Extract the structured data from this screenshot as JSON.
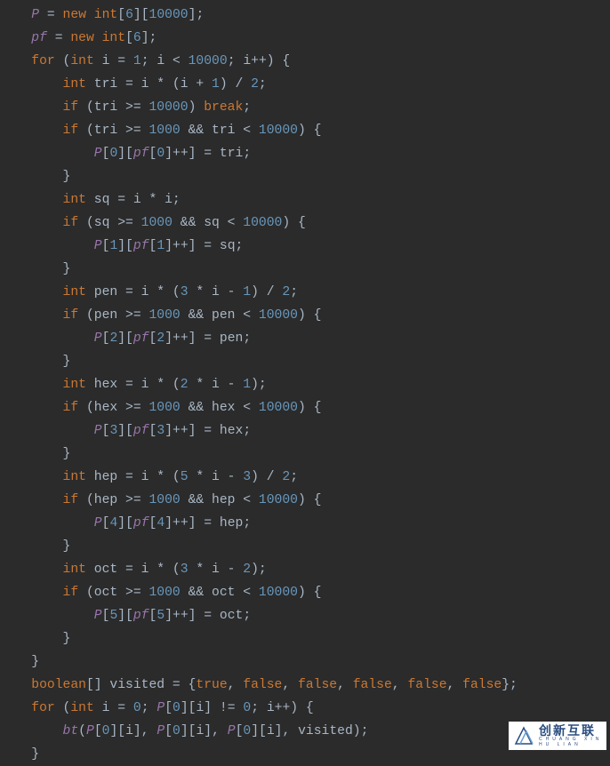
{
  "code": {
    "lines": [
      {
        "indent": 1,
        "tokens": [
          {
            "t": "field",
            "v": "P"
          },
          {
            "t": "op",
            "v": " = "
          },
          {
            "t": "kw",
            "v": "new int"
          },
          {
            "t": "op",
            "v": "["
          },
          {
            "t": "num",
            "v": "6"
          },
          {
            "t": "op",
            "v": "]["
          },
          {
            "t": "num",
            "v": "10000"
          },
          {
            "t": "op",
            "v": "];"
          }
        ]
      },
      {
        "indent": 1,
        "tokens": [
          {
            "t": "field",
            "v": "pf"
          },
          {
            "t": "op",
            "v": " = "
          },
          {
            "t": "kw",
            "v": "new int"
          },
          {
            "t": "op",
            "v": "["
          },
          {
            "t": "num",
            "v": "6"
          },
          {
            "t": "op",
            "v": "];"
          }
        ]
      },
      {
        "indent": 1,
        "tokens": [
          {
            "t": "kw",
            "v": "for"
          },
          {
            "t": "op",
            "v": " ("
          },
          {
            "t": "kw",
            "v": "int"
          },
          {
            "t": "op",
            "v": " i = "
          },
          {
            "t": "num",
            "v": "1"
          },
          {
            "t": "op",
            "v": "; i < "
          },
          {
            "t": "num",
            "v": "10000"
          },
          {
            "t": "op",
            "v": "; i++) {"
          }
        ]
      },
      {
        "indent": 2,
        "tokens": [
          {
            "t": "kw",
            "v": "int"
          },
          {
            "t": "op",
            "v": " tri = i * (i + "
          },
          {
            "t": "num",
            "v": "1"
          },
          {
            "t": "op",
            "v": ") / "
          },
          {
            "t": "num",
            "v": "2"
          },
          {
            "t": "op",
            "v": ";"
          }
        ]
      },
      {
        "indent": 2,
        "tokens": [
          {
            "t": "kw",
            "v": "if"
          },
          {
            "t": "op",
            "v": " (tri >= "
          },
          {
            "t": "num",
            "v": "10000"
          },
          {
            "t": "op",
            "v": ") "
          },
          {
            "t": "kw",
            "v": "break"
          },
          {
            "t": "op",
            "v": ";"
          }
        ]
      },
      {
        "indent": 2,
        "tokens": [
          {
            "t": "kw",
            "v": "if"
          },
          {
            "t": "op",
            "v": " (tri >= "
          },
          {
            "t": "num",
            "v": "1000"
          },
          {
            "t": "op",
            "v": " && tri < "
          },
          {
            "t": "num",
            "v": "10000"
          },
          {
            "t": "op",
            "v": ") {"
          }
        ]
      },
      {
        "indent": 3,
        "tokens": [
          {
            "t": "field",
            "v": "P"
          },
          {
            "t": "op",
            "v": "["
          },
          {
            "t": "num",
            "v": "0"
          },
          {
            "t": "op",
            "v": "]["
          },
          {
            "t": "field",
            "v": "pf"
          },
          {
            "t": "op",
            "v": "["
          },
          {
            "t": "num",
            "v": "0"
          },
          {
            "t": "op",
            "v": "]++] = tri;"
          }
        ]
      },
      {
        "indent": 2,
        "tokens": [
          {
            "t": "op",
            "v": "}"
          }
        ]
      },
      {
        "indent": 2,
        "tokens": [
          {
            "t": "kw",
            "v": "int"
          },
          {
            "t": "op",
            "v": " sq = i * i;"
          }
        ]
      },
      {
        "indent": 2,
        "tokens": [
          {
            "t": "kw",
            "v": "if"
          },
          {
            "t": "op",
            "v": " (sq >= "
          },
          {
            "t": "num",
            "v": "1000"
          },
          {
            "t": "op",
            "v": " && sq < "
          },
          {
            "t": "num",
            "v": "10000"
          },
          {
            "t": "op",
            "v": ") {"
          }
        ]
      },
      {
        "indent": 3,
        "tokens": [
          {
            "t": "field",
            "v": "P"
          },
          {
            "t": "op",
            "v": "["
          },
          {
            "t": "num",
            "v": "1"
          },
          {
            "t": "op",
            "v": "]["
          },
          {
            "t": "field",
            "v": "pf"
          },
          {
            "t": "op",
            "v": "["
          },
          {
            "t": "num",
            "v": "1"
          },
          {
            "t": "op",
            "v": "]++] = sq;"
          }
        ]
      },
      {
        "indent": 2,
        "tokens": [
          {
            "t": "op",
            "v": "}"
          }
        ]
      },
      {
        "indent": 2,
        "tokens": [
          {
            "t": "kw",
            "v": "int"
          },
          {
            "t": "op",
            "v": " pen = i * ("
          },
          {
            "t": "num",
            "v": "3"
          },
          {
            "t": "op",
            "v": " * i - "
          },
          {
            "t": "num",
            "v": "1"
          },
          {
            "t": "op",
            "v": ") / "
          },
          {
            "t": "num",
            "v": "2"
          },
          {
            "t": "op",
            "v": ";"
          }
        ]
      },
      {
        "indent": 2,
        "tokens": [
          {
            "t": "kw",
            "v": "if"
          },
          {
            "t": "op",
            "v": " (pen >= "
          },
          {
            "t": "num",
            "v": "1000"
          },
          {
            "t": "op",
            "v": " && pen < "
          },
          {
            "t": "num",
            "v": "10000"
          },
          {
            "t": "op",
            "v": ") {"
          }
        ]
      },
      {
        "indent": 3,
        "tokens": [
          {
            "t": "field",
            "v": "P"
          },
          {
            "t": "op",
            "v": "["
          },
          {
            "t": "num",
            "v": "2"
          },
          {
            "t": "op",
            "v": "]["
          },
          {
            "t": "field",
            "v": "pf"
          },
          {
            "t": "op",
            "v": "["
          },
          {
            "t": "num",
            "v": "2"
          },
          {
            "t": "op",
            "v": "]++] = pen;"
          }
        ]
      },
      {
        "indent": 2,
        "tokens": [
          {
            "t": "op",
            "v": "}"
          }
        ]
      },
      {
        "indent": 2,
        "tokens": [
          {
            "t": "kw",
            "v": "int"
          },
          {
            "t": "op",
            "v": " hex = i * ("
          },
          {
            "t": "num",
            "v": "2"
          },
          {
            "t": "op",
            "v": " * i - "
          },
          {
            "t": "num",
            "v": "1"
          },
          {
            "t": "op",
            "v": ");"
          }
        ]
      },
      {
        "indent": 2,
        "tokens": [
          {
            "t": "kw",
            "v": "if"
          },
          {
            "t": "op",
            "v": " (hex >= "
          },
          {
            "t": "num",
            "v": "1000"
          },
          {
            "t": "op",
            "v": " && hex < "
          },
          {
            "t": "num",
            "v": "10000"
          },
          {
            "t": "op",
            "v": ") {"
          }
        ]
      },
      {
        "indent": 3,
        "tokens": [
          {
            "t": "field",
            "v": "P"
          },
          {
            "t": "op",
            "v": "["
          },
          {
            "t": "num",
            "v": "3"
          },
          {
            "t": "op",
            "v": "]["
          },
          {
            "t": "field",
            "v": "pf"
          },
          {
            "t": "op",
            "v": "["
          },
          {
            "t": "num",
            "v": "3"
          },
          {
            "t": "op",
            "v": "]++] = hex;"
          }
        ]
      },
      {
        "indent": 2,
        "tokens": [
          {
            "t": "op",
            "v": "}"
          }
        ]
      },
      {
        "indent": 2,
        "tokens": [
          {
            "t": "kw",
            "v": "int"
          },
          {
            "t": "op",
            "v": " hep = i * ("
          },
          {
            "t": "num",
            "v": "5"
          },
          {
            "t": "op",
            "v": " * i - "
          },
          {
            "t": "num",
            "v": "3"
          },
          {
            "t": "op",
            "v": ") / "
          },
          {
            "t": "num",
            "v": "2"
          },
          {
            "t": "op",
            "v": ";"
          }
        ]
      },
      {
        "indent": 2,
        "tokens": [
          {
            "t": "kw",
            "v": "if"
          },
          {
            "t": "op",
            "v": " (hep >= "
          },
          {
            "t": "num",
            "v": "1000"
          },
          {
            "t": "op",
            "v": " && hep < "
          },
          {
            "t": "num",
            "v": "10000"
          },
          {
            "t": "op",
            "v": ") {"
          }
        ]
      },
      {
        "indent": 3,
        "tokens": [
          {
            "t": "field",
            "v": "P"
          },
          {
            "t": "op",
            "v": "["
          },
          {
            "t": "num",
            "v": "4"
          },
          {
            "t": "op",
            "v": "]["
          },
          {
            "t": "field",
            "v": "pf"
          },
          {
            "t": "op",
            "v": "["
          },
          {
            "t": "num",
            "v": "4"
          },
          {
            "t": "op",
            "v": "]++] = hep;"
          }
        ]
      },
      {
        "indent": 2,
        "tokens": [
          {
            "t": "op",
            "v": "}"
          }
        ]
      },
      {
        "indent": 2,
        "tokens": [
          {
            "t": "kw",
            "v": "int"
          },
          {
            "t": "op",
            "v": " oct = i * ("
          },
          {
            "t": "num",
            "v": "3"
          },
          {
            "t": "op",
            "v": " * i - "
          },
          {
            "t": "num",
            "v": "2"
          },
          {
            "t": "op",
            "v": ");"
          }
        ]
      },
      {
        "indent": 2,
        "tokens": [
          {
            "t": "kw",
            "v": "if"
          },
          {
            "t": "op",
            "v": " (oct >= "
          },
          {
            "t": "num",
            "v": "1000"
          },
          {
            "t": "op",
            "v": " && oct < "
          },
          {
            "t": "num",
            "v": "10000"
          },
          {
            "t": "op",
            "v": ") {"
          }
        ]
      },
      {
        "indent": 3,
        "tokens": [
          {
            "t": "field",
            "v": "P"
          },
          {
            "t": "op",
            "v": "["
          },
          {
            "t": "num",
            "v": "5"
          },
          {
            "t": "op",
            "v": "]["
          },
          {
            "t": "field",
            "v": "pf"
          },
          {
            "t": "op",
            "v": "["
          },
          {
            "t": "num",
            "v": "5"
          },
          {
            "t": "op",
            "v": "]++] = oct;"
          }
        ]
      },
      {
        "indent": 2,
        "tokens": [
          {
            "t": "op",
            "v": "}"
          }
        ]
      },
      {
        "indent": 1,
        "tokens": [
          {
            "t": "op",
            "v": "}"
          }
        ]
      },
      {
        "indent": 1,
        "tokens": [
          {
            "t": "kw",
            "v": "boolean"
          },
          {
            "t": "op",
            "v": "[] visited = {"
          },
          {
            "t": "kw",
            "v": "true"
          },
          {
            "t": "op",
            "v": ", "
          },
          {
            "t": "kw",
            "v": "false"
          },
          {
            "t": "op",
            "v": ", "
          },
          {
            "t": "kw",
            "v": "false"
          },
          {
            "t": "op",
            "v": ", "
          },
          {
            "t": "kw",
            "v": "false"
          },
          {
            "t": "op",
            "v": ", "
          },
          {
            "t": "kw",
            "v": "false"
          },
          {
            "t": "op",
            "v": ", "
          },
          {
            "t": "kw",
            "v": "false"
          },
          {
            "t": "op",
            "v": "};"
          }
        ]
      },
      {
        "indent": 1,
        "tokens": [
          {
            "t": "kw",
            "v": "for"
          },
          {
            "t": "op",
            "v": " ("
          },
          {
            "t": "kw",
            "v": "int"
          },
          {
            "t": "op",
            "v": " i = "
          },
          {
            "t": "num",
            "v": "0"
          },
          {
            "t": "op",
            "v": "; "
          },
          {
            "t": "field",
            "v": "P"
          },
          {
            "t": "op",
            "v": "["
          },
          {
            "t": "num",
            "v": "0"
          },
          {
            "t": "op",
            "v": "][i] != "
          },
          {
            "t": "num",
            "v": "0"
          },
          {
            "t": "op",
            "v": "; i++) {"
          }
        ]
      },
      {
        "indent": 2,
        "tokens": [
          {
            "t": "field",
            "v": "bt"
          },
          {
            "t": "op",
            "v": "("
          },
          {
            "t": "field",
            "v": "P"
          },
          {
            "t": "op",
            "v": "["
          },
          {
            "t": "num",
            "v": "0"
          },
          {
            "t": "op",
            "v": "][i], "
          },
          {
            "t": "field",
            "v": "P"
          },
          {
            "t": "op",
            "v": "["
          },
          {
            "t": "num",
            "v": "0"
          },
          {
            "t": "op",
            "v": "][i], "
          },
          {
            "t": "field",
            "v": "P"
          },
          {
            "t": "op",
            "v": "["
          },
          {
            "t": "num",
            "v": "0"
          },
          {
            "t": "op",
            "v": "][i], visited);"
          }
        ]
      },
      {
        "indent": 1,
        "tokens": [
          {
            "t": "op",
            "v": "}"
          }
        ]
      }
    ],
    "indent_unit": "    "
  },
  "watermark": {
    "main": "创新互联",
    "sub": "CHUANG XIN HU LIAN"
  }
}
